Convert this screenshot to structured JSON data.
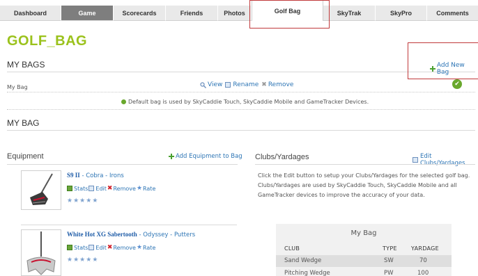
{
  "nav": {
    "tabs": [
      "Dashboard",
      "Game",
      "Scorecards",
      "Friends",
      "Photos",
      "Golf Bag",
      "SkyTrak",
      "SkyPro",
      "Comments"
    ],
    "active": "Golf Bag"
  },
  "page": {
    "title": "GOLF_BAG"
  },
  "my_bags": {
    "heading": "MY BAGS",
    "add_label": "Add New Bag",
    "bag_name": "My Bag",
    "actions": {
      "view": "View",
      "rename": "Rename",
      "remove": "Remove"
    },
    "note": "Default bag is used by SkyCaddie Touch, SkyCaddie Mobile and GameTracker Devices."
  },
  "my_bag": {
    "heading": "MY BAG"
  },
  "equipment": {
    "heading": "Equipment",
    "add_label": "Add Equipment to Bag",
    "items": [
      {
        "name": "S9 II",
        "brand": "Cobra",
        "category": "Irons",
        "sep": " - ",
        "stats": "Stats",
        "edit": "Edit",
        "remove": "Remove",
        "rate": "Rate"
      },
      {
        "name": "White Hot XG Sabertooth",
        "brand": "Odyssey",
        "category": "Putters",
        "sep": " - ",
        "stats": "Stats",
        "edit": "Edit",
        "remove": "Remove",
        "rate": "Rate"
      }
    ]
  },
  "clubs": {
    "heading": "Clubs/Yardages",
    "edit_label": "Edit Clubs/Yardages",
    "description": "Click the Edit button to setup your Clubs/Yardages for the selected golf bag. Clubs/Yardages are used by SkyCaddie Touch, SkyCaddie Mobile and all GameTracker devices to improve the accuracy of your data.",
    "table": {
      "caption": "My Bag",
      "headers": {
        "club": "CLUB",
        "type": "TYPE",
        "yardage": "YARDAGE"
      },
      "rows": [
        {
          "club": "Sand Wedge",
          "type": "SW",
          "yardage": "70"
        },
        {
          "club": "Pitching Wedge",
          "type": "PW",
          "yardage": "100"
        }
      ]
    }
  },
  "colors": {
    "accent_green": "#9bc21c",
    "link_blue": "#2d75b5",
    "highlight_red": "#c0393b"
  }
}
